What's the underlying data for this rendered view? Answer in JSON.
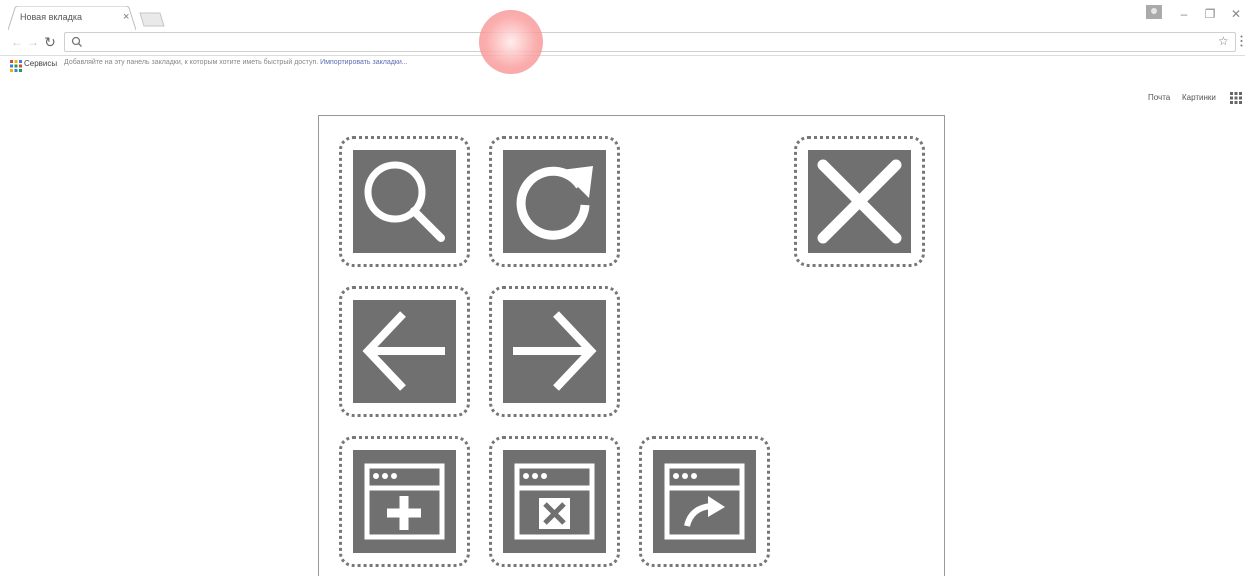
{
  "browser": {
    "tab_title": "Новая вкладка",
    "tab_close": "×",
    "omnibox_value": "",
    "bookmarks_bar": {
      "apps_label": "Сервисы",
      "prompt_text": "Добавляйте на эту панель закладки, к которым хотите иметь быстрый доступ.",
      "import_link": "Импортировать закладки..."
    }
  },
  "google": {
    "mail_link": "Почта",
    "images_link": "Картинки"
  },
  "icons": [
    {
      "name": "search-icon"
    },
    {
      "name": "reload-icon"
    },
    {
      "name": "close-icon"
    },
    {
      "name": "back-arrow-icon"
    },
    {
      "name": "forward-arrow-icon"
    },
    {
      "name": "new-window-icon"
    },
    {
      "name": "close-window-icon"
    },
    {
      "name": "share-window-icon"
    }
  ],
  "colors": {
    "tile_fill": "#707070",
    "tile_border": "#777777",
    "click_marker": "#f39a9a",
    "link": "#5a6fb6"
  }
}
